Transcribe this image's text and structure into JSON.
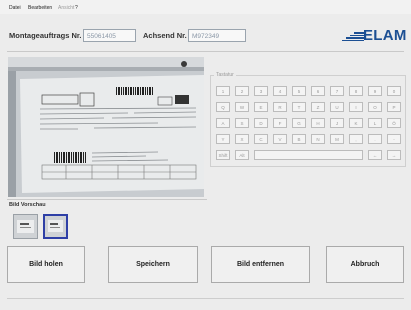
{
  "menu": [
    "Datei",
    "Bearbeiten",
    "Ansicht",
    "?"
  ],
  "header": {
    "order_label": "Montageauftrags Nr.",
    "order_value": "55061405",
    "frame_label": "Achsend Nr.",
    "frame_value": "M972349",
    "logo_text": "ELAM"
  },
  "keypad": {
    "title": "Tastatur",
    "rows": [
      [
        "1",
        "2",
        "3",
        "4",
        "5",
        "6",
        "7",
        "8",
        "9",
        "0"
      ],
      [
        "Q",
        "W",
        "E",
        "R",
        "T",
        "Z",
        "U",
        "I",
        "O",
        "P"
      ],
      [
        "A",
        "S",
        "D",
        "F",
        "G",
        "H",
        "J",
        "K",
        "L",
        "Ö"
      ],
      [
        "Y",
        "X",
        "C",
        "V",
        "B",
        "N",
        "M",
        ",",
        ".",
        "-"
      ],
      [
        "Shift",
        "Alt",
        "",
        "←",
        "→"
      ]
    ]
  },
  "preview": {
    "label": "Bild Vorschau"
  },
  "buttons": {
    "get_image": "Bild holen",
    "save": "Speichern",
    "remove_image": "Bild entfernen",
    "cancel": "Abbruch"
  },
  "colors": {
    "logo": "#1c4f93",
    "thumb_selected": "#2e3fa6"
  }
}
